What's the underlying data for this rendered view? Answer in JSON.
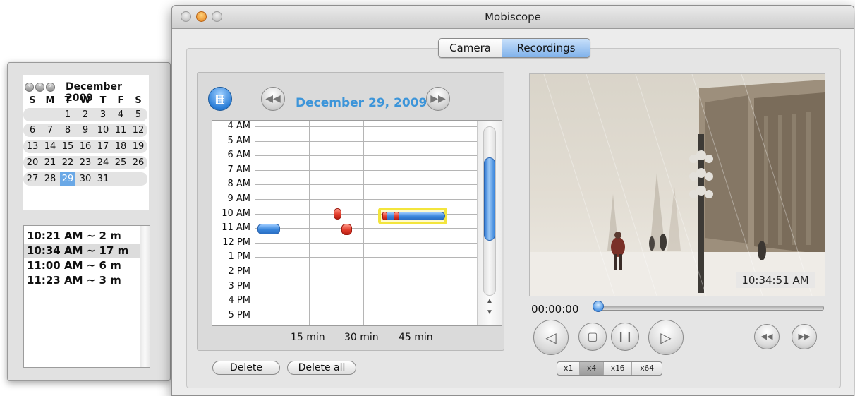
{
  "window": {
    "title": "Mobiscope"
  },
  "tabs": {
    "camera": "Camera",
    "recordings": "Recordings",
    "selected": "Recordings"
  },
  "calendar": {
    "month_title": "December 2009",
    "weekdays": [
      "S",
      "M",
      "T",
      "W",
      "T",
      "F",
      "S"
    ],
    "weeks": [
      [
        "",
        "",
        "1",
        "2",
        "3",
        "4",
        "5"
      ],
      [
        "6",
        "7",
        "8",
        "9",
        "10",
        "11",
        "12"
      ],
      [
        "13",
        "14",
        "15",
        "16",
        "17",
        "18",
        "19"
      ],
      [
        "20",
        "21",
        "22",
        "23",
        "24",
        "25",
        "26"
      ],
      [
        "27",
        "28",
        "29",
        "30",
        "31",
        "",
        ""
      ]
    ],
    "selected_day": "29"
  },
  "recording_list": {
    "items": [
      "10:21 AM ~ 2 m",
      "10:34 AM ~ 17 m",
      "11:00 AM ~ 6 m",
      "11:23 AM ~ 3 m"
    ],
    "selected_index": 1
  },
  "timeline": {
    "date_title": "December 29, 2009",
    "hours": [
      "4 AM",
      "5 AM",
      "6 AM",
      "7 AM",
      "8 AM",
      "9 AM",
      "10 AM",
      "11 AM",
      "12 PM",
      "1 PM",
      "2 PM",
      "3 PM",
      "4 PM",
      "5 PM"
    ],
    "minute_labels": [
      "15 min",
      "30 min",
      "45 min"
    ],
    "icons": {
      "calendar": "calendar-icon",
      "prev": "rewind-icon",
      "next": "fast-forward-icon"
    },
    "colors": {
      "recording": "#3a86dc",
      "event": "#e23b2a",
      "selection": "#f3e53c",
      "date_title": "#3d95d9"
    }
  },
  "actions": {
    "delete": "Delete",
    "delete_all": "Delete all"
  },
  "player": {
    "timestamp_overlay": "10:34:51 AM",
    "elapsed": "00:00:00",
    "progress": 0,
    "speeds": [
      "x1",
      "x4",
      "x16",
      "x64"
    ],
    "selected_speed": "x4"
  }
}
